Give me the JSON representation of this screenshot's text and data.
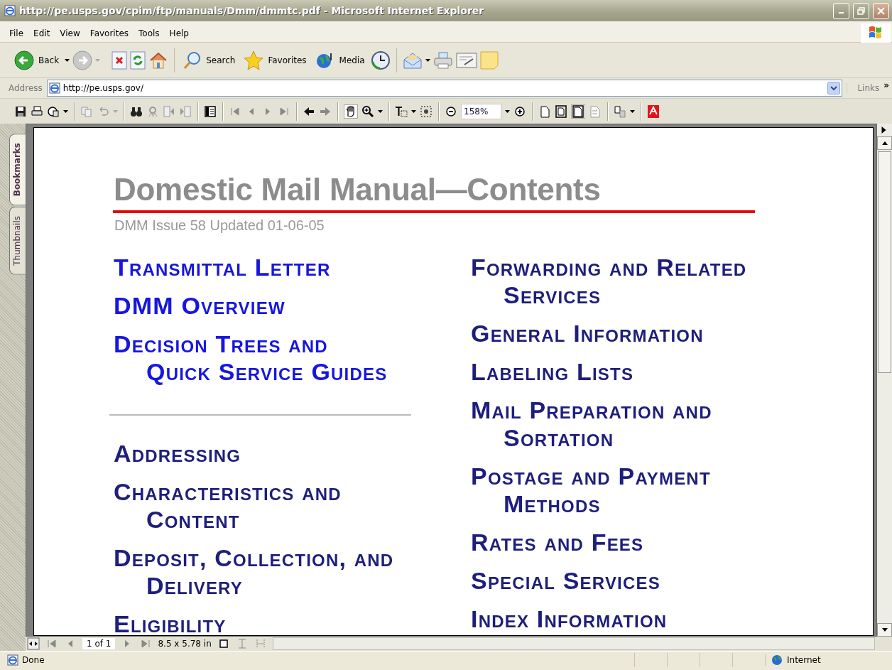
{
  "window": {
    "title": "http://pe.usps.gov/cpim/ftp/manuals/Dmm/dmmtc.pdf - Microsoft Internet Explorer"
  },
  "menu": [
    "File",
    "Edit",
    "View",
    "Favorites",
    "Tools",
    "Help"
  ],
  "toolbar": {
    "back": "Back",
    "search": "Search",
    "favorites": "Favorites",
    "media": "Media"
  },
  "address": {
    "label": "Address",
    "value": "http://pe.usps.gov/",
    "links": "Links",
    "more": "»"
  },
  "pdf_toolbar": {
    "zoom": "158%"
  },
  "side_tabs": [
    {
      "label": "Bookmarks",
      "selected": true
    },
    {
      "label": "Thumbnails",
      "selected": false
    }
  ],
  "document": {
    "title": "Domestic Mail Manual—Contents",
    "subtitle": "DMM Issue 58 Updated 01-06-05",
    "columns": [
      {
        "sections": [
          {
            "items": [
              {
                "text": "Transmittal Letter",
                "color": "#1616e0"
              },
              {
                "text": "DMM Overview",
                "color": "#1616e0"
              },
              {
                "text": "Decision Trees and\nQuick Service Guides",
                "color": "#1616e0"
              }
            ]
          },
          {
            "items": [
              {
                "text": "Addressing",
                "color": "#1e1e7c"
              },
              {
                "text": "Characteristics and\nContent",
                "color": "#1e1e7c"
              },
              {
                "text": "Deposit, Collection, and\nDelivery",
                "color": "#1e1e7c"
              },
              {
                "text": "Eligibility",
                "color": "#1e1e7c"
              }
            ]
          }
        ]
      },
      {
        "sections": [
          {
            "items": [
              {
                "text": "Forwarding and Related\nServices",
                "color": "#1e1e7c"
              },
              {
                "text": "General Information",
                "color": "#1e1e7c"
              },
              {
                "text": "Labeling Lists",
                "color": "#1e1e7c"
              },
              {
                "text": "Mail Preparation and\nSortation",
                "color": "#1e1e7c"
              },
              {
                "text": "Postage and Payment\nMethods",
                "color": "#1e1e7c"
              },
              {
                "text": "Rates and Fees",
                "color": "#1e1e7c"
              },
              {
                "text": "Special Services",
                "color": "#1e1e7c"
              },
              {
                "text": "Index Information",
                "color": "#1e1e7c"
              }
            ]
          }
        ]
      }
    ]
  },
  "pdf_status": {
    "page": "1 of 1",
    "size": "8.5 x 5.78 in"
  },
  "status_bar": {
    "text": "Done",
    "zone": "Internet"
  }
}
